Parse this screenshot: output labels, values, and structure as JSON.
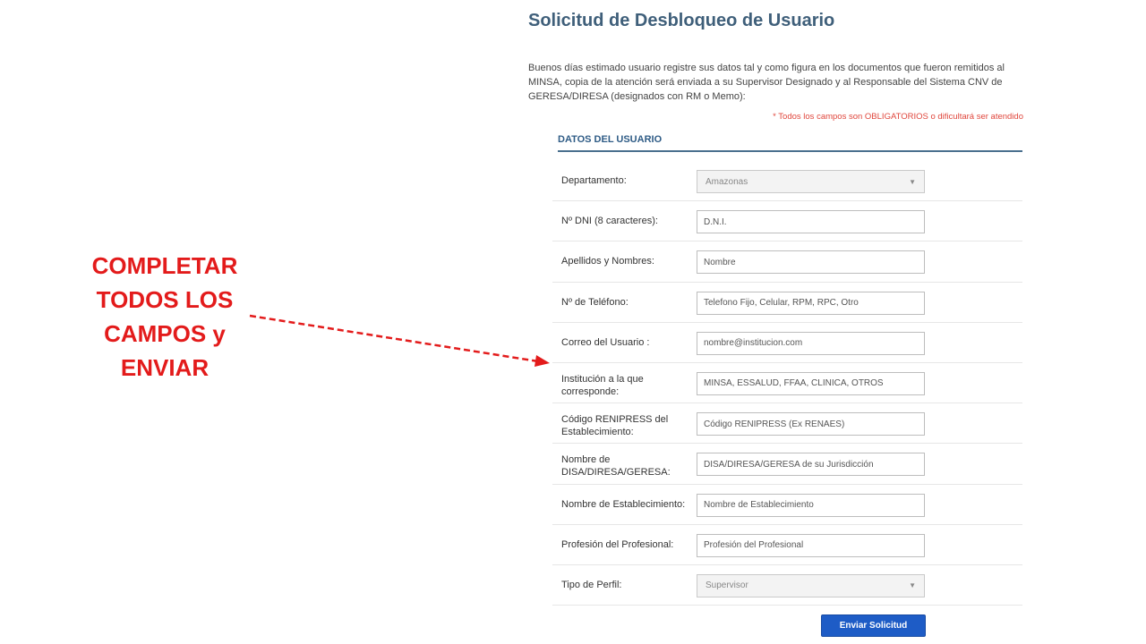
{
  "annotation": {
    "lines": [
      "COMPLETAR",
      "TODOS LOS",
      "CAMPOS  y",
      "ENVIAR"
    ],
    "color": "#e31b1b"
  },
  "form": {
    "title": "Solicitud de Desbloqueo de Usuario",
    "intro": "Buenos días estimado usuario registre sus datos tal y como figura en los documentos que fueron remitidos al MINSA, copia de la atención será enviada a su Supervisor Designado y al Responsable del Sistema CNV de GERESA/DIRESA (designados con RM o Memo):",
    "required_note": "* Todos los campos son OBLIGATORIOS o dificultará ser atendido",
    "section_title": "DATOS DEL USUARIO",
    "fields": {
      "departamento": {
        "label": "Departamento:",
        "value": "Amazonas"
      },
      "dni": {
        "label": "Nº DNI (8 caracteres):",
        "placeholder": "D.N.I."
      },
      "nombres": {
        "label": "Apellidos y Nombres:",
        "placeholder": "Nombre"
      },
      "telefono": {
        "label": "Nº de Teléfono:",
        "placeholder": "Telefono Fijo, Celular, RPM, RPC, Otro"
      },
      "correo": {
        "label": "Correo del Usuario :",
        "placeholder": "nombre@institucion.com"
      },
      "institucion": {
        "label": "Institución a la que corresponde:",
        "placeholder": "MINSA, ESSALUD, FFAA, CLINICA, OTROS"
      },
      "renipress": {
        "label": "Código RENIPRESS del Establecimiento:",
        "placeholder": "Código RENIPRESS (Ex RENAES)"
      },
      "disa": {
        "label": "Nombre de DISA/DIRESA/GERESA:",
        "placeholder": "DISA/DIRESA/GERESA de su Jurisdicción"
      },
      "establecimiento": {
        "label": "Nombre de Establecimiento:",
        "placeholder": "Nombre de Establecimiento"
      },
      "profesion": {
        "label": "Profesión del Profesional:",
        "placeholder": "Profesión del Profesional"
      },
      "perfil": {
        "label": "Tipo de Perfil:",
        "value": "Supervisor"
      }
    },
    "caret_glyph": "▼",
    "submit_label": "Enviar Solicitud",
    "colors": {
      "title": "#3f5f7a",
      "section": "#2f5c86",
      "required": "#e0463c",
      "button": "#1e5cc6"
    }
  }
}
